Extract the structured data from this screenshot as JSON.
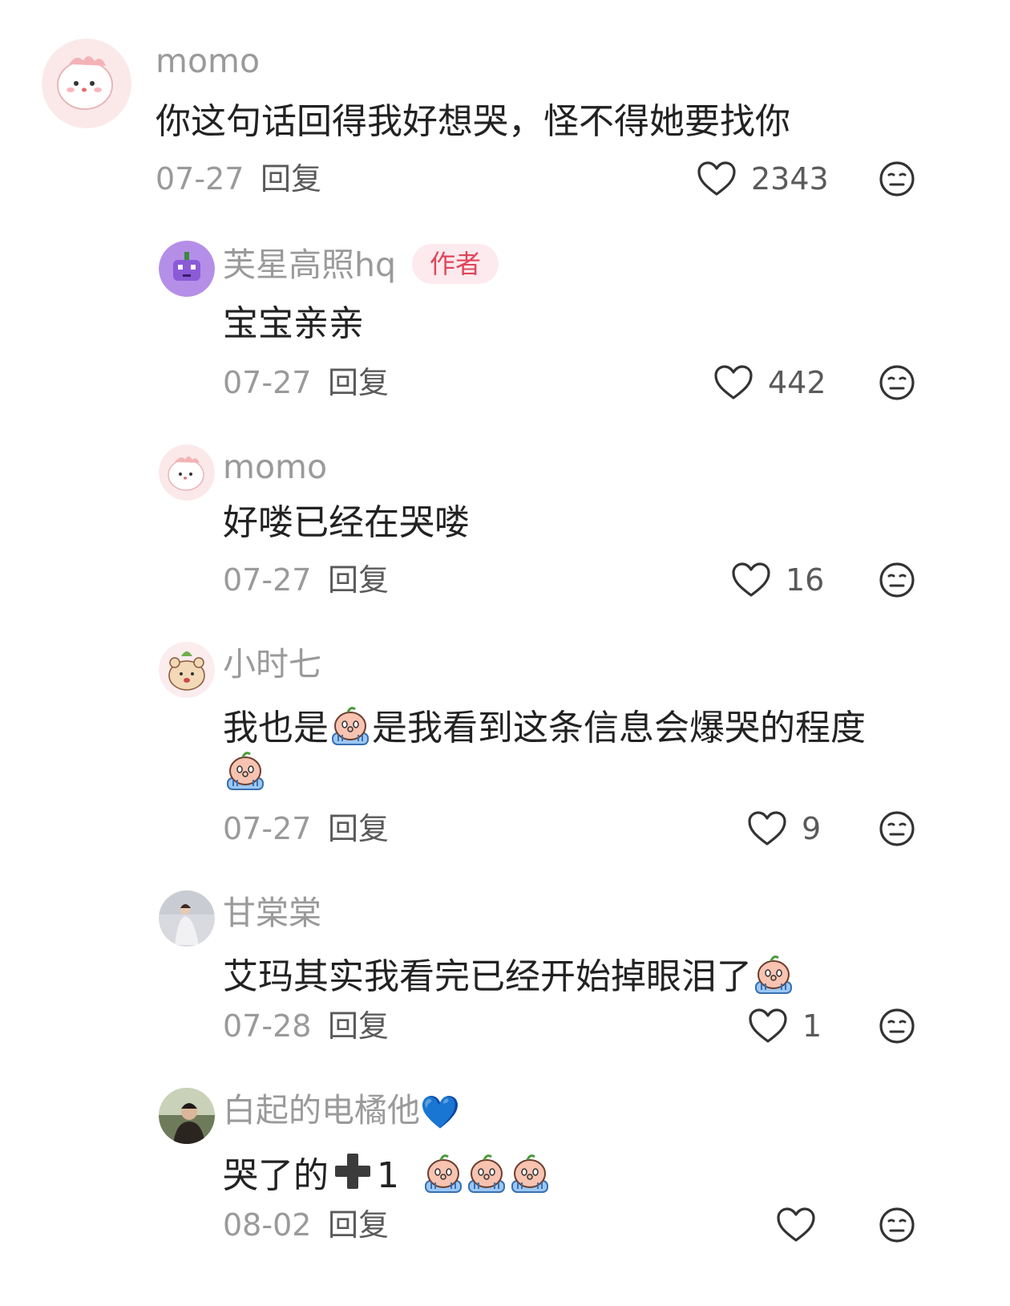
{
  "colors": {
    "author_badge_text": "#e0455a",
    "author_badge_bg": "#fdeaee",
    "meta": "#9a9a9a"
  },
  "icons": {
    "like": "heart-outline-icon",
    "dislike": "neutral-face-icon",
    "cry": "crying-sticker-icon",
    "plus": "heavy-plus-icon"
  },
  "comments": [
    {
      "user": "momo",
      "text": "你这句话回得我好想哭，怪不得她要找你",
      "date": "07-27",
      "reply": "回复",
      "likes": "2343"
    },
    {
      "user": "芙星高照hq",
      "badge": "作者",
      "text": "宝宝亲亲",
      "date": "07-27",
      "reply": "回复",
      "likes": "442"
    },
    {
      "user": "momo",
      "text": "好喽已经在哭喽",
      "date": "07-27",
      "reply": "回复",
      "likes": "16"
    },
    {
      "user": "小时七",
      "text_before": "我也是",
      "text_after": "是我看到这条信息会爆哭的程度",
      "date": "07-27",
      "reply": "回复",
      "likes": "9"
    },
    {
      "user": "甘棠棠",
      "text": "艾玛其实我看完已经开始掉眼泪了",
      "date": "07-28",
      "reply": "回复",
      "likes": "1"
    },
    {
      "user": "白起的电橘他",
      "user_emoji": "💙",
      "text_before": "哭了的",
      "text_after": "1",
      "date": "08-02",
      "reply": "回复",
      "likes": ""
    }
  ]
}
